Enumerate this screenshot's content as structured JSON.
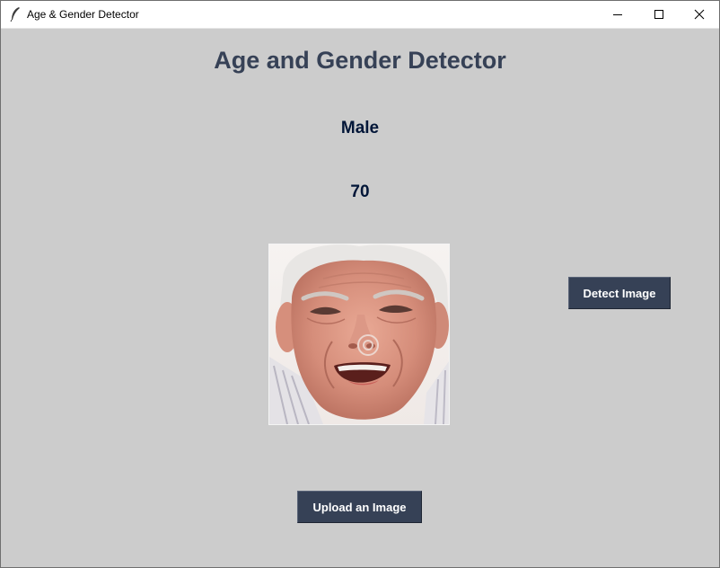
{
  "window": {
    "title": "Age & Gender Detector",
    "icons": {
      "app": "feather-icon",
      "minimize": "minimize-icon",
      "maximize": "maximize-icon",
      "close": "close-icon"
    }
  },
  "main": {
    "heading": "Age and Gender Detector",
    "gender_result": "Male",
    "age_result": "70",
    "photo_description_icon": "uploaded-face-image",
    "detect_button_label": "Detect Image",
    "upload_button_label": "Upload an Image"
  },
  "colors": {
    "background": "#cccccc",
    "heading": "#364156",
    "result_text": "#011638",
    "button_bg": "#364156",
    "button_text": "#ffffff"
  }
}
